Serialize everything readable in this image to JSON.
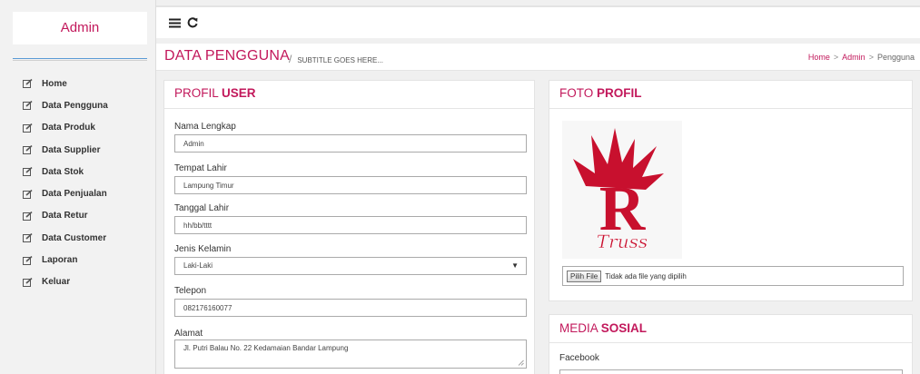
{
  "sidebar": {
    "brand": "Admin",
    "items": [
      {
        "label": "Home",
        "icon": "edit-icon"
      },
      {
        "label": "Data Pengguna",
        "icon": "edit-icon"
      },
      {
        "label": "Data Produk",
        "icon": "edit-icon"
      },
      {
        "label": "Data Supplier",
        "icon": "edit-icon"
      },
      {
        "label": "Data Stok",
        "icon": "edit-icon"
      },
      {
        "label": "Data Penjualan",
        "icon": "edit-icon"
      },
      {
        "label": "Data Retur",
        "icon": "edit-icon"
      },
      {
        "label": "Data Customer",
        "icon": "edit-icon"
      },
      {
        "label": "Laporan",
        "icon": "edit-icon"
      },
      {
        "label": "Keluar",
        "icon": "edit-icon"
      }
    ]
  },
  "topbar": {
    "menu_icon": "hamburger-icon",
    "refresh_icon": "refresh-icon"
  },
  "header": {
    "title": "DATA PENGGUNA",
    "separator": "/",
    "subtitle": "SUBTITLE GOES HERE...",
    "breadcrumb": [
      "Home",
      "Admin",
      "Pengguna"
    ],
    "breadcrumb_sep": ">"
  },
  "profile": {
    "title_plain": "PROFIL",
    "title_bold": "USER",
    "fields": {
      "nama_label": "Nama Lengkap",
      "nama_value": "Admin",
      "tempat_label": "Tempat Lahir",
      "tempat_value": "Lampung Timur",
      "tanggal_label": "Tanggal Lahir",
      "tanggal_value": "hh/bb/tttt",
      "kelamin_label": "Jenis Kelamin",
      "kelamin_value": "Laki-Laki",
      "telepon_label": "Telepon",
      "telepon_value": "082176160077",
      "alamat_label": "Alamat",
      "alamat_value": "Jl. Putri Balau No. 22 Kedamaian Bandar Lampung"
    }
  },
  "foto": {
    "title_plain": "FOTO",
    "title_bold": "PROFIL",
    "logo_text": "Truss",
    "file_button": "Pilih File",
    "file_status": "Tidak ada file yang dipilih"
  },
  "media": {
    "title_plain": "MEDIA",
    "title_bold": "SOSIAL",
    "facebook_label": "Facebook"
  },
  "colors": {
    "accent": "#c2185b",
    "logo_red": "#c8102e"
  }
}
